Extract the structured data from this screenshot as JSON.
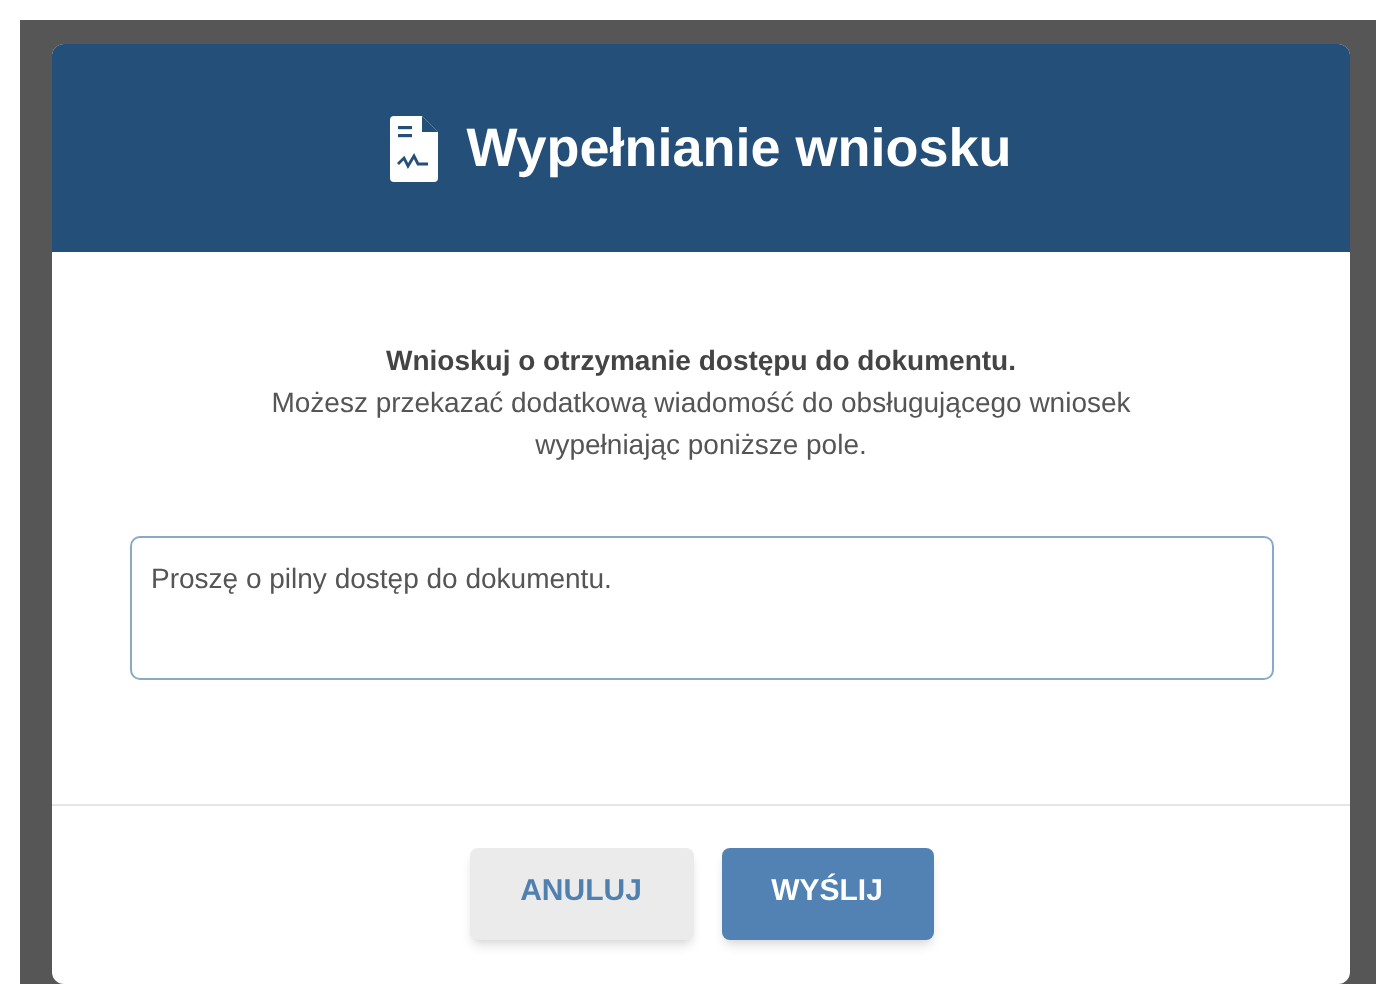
{
  "dialog": {
    "title": "Wypełnianie wniosku",
    "heading": "Wnioskuj o otrzymanie dostępu do dokumentu.",
    "description": "Możesz przekazać dodatkową wiadomość do obsługującego wniosek wypełniając poniższe pole.",
    "message": {
      "value": "Proszę o pilny dostęp do dokumentu."
    },
    "buttons": [
      {
        "label": "ANULUJ",
        "kind": "secondary"
      },
      {
        "label": "WYŚLIJ",
        "kind": "primary"
      }
    ]
  }
}
